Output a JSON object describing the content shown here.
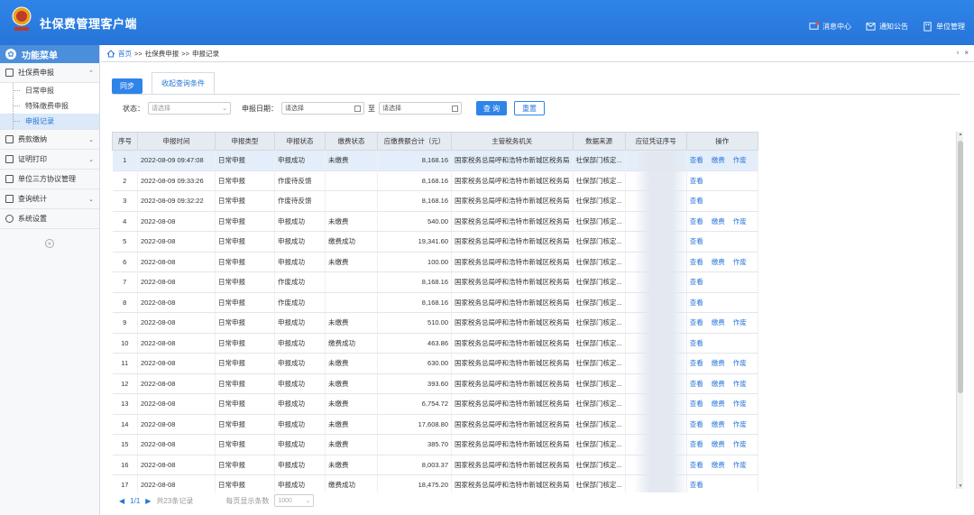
{
  "app": {
    "title": "社保费管理客户端",
    "logo_text": "中国税务"
  },
  "header_links": [
    {
      "icon": "message-icon",
      "label": "消息中心"
    },
    {
      "icon": "notice-icon",
      "label": "通知公告"
    },
    {
      "icon": "unit-icon",
      "label": "单位管理"
    }
  ],
  "sidebar": {
    "title": "功能菜单",
    "groups": [
      {
        "label": "社保费申报",
        "expanded": true,
        "items": [
          "日常申报",
          "特殊缴费申报",
          "申报记录"
        ]
      },
      {
        "label": "费款缴纳"
      },
      {
        "label": "证明打印"
      },
      {
        "label": "单位三方协议管理"
      },
      {
        "label": "查询统计"
      },
      {
        "label": "系统设置"
      }
    ]
  },
  "breadcrumb": {
    "home": "首页",
    "sep": ">>",
    "level1": "社保费申报",
    "level2": "申报记录"
  },
  "toolbar": {
    "sync_label": "同步",
    "tab_label": "收起查询条件"
  },
  "filter": {
    "status_label": "状态：",
    "status_placeholder": "请选择",
    "date_label": "申报日期：",
    "date_from_placeholder": "请选择",
    "to_label": "至",
    "date_to_placeholder": "请选择",
    "query_label": "查 询",
    "reset_label": "重置"
  },
  "table": {
    "headers": [
      "序号",
      "申报时间",
      "申报类型",
      "申报状态",
      "缴费状态",
      "应缴费额合计（元）",
      "主管税务机关",
      "数据来源",
      "应征凭证序号",
      "操作"
    ],
    "ops": {
      "view": "查看",
      "pay": "缴费",
      "void": "作废"
    },
    "rows": [
      {
        "no": "1",
        "time": "2022-08-09 09:47:08",
        "type": "日常申报",
        "status": "申报成功",
        "pay": "未缴费",
        "amount": "8,168.16",
        "org": "国家税务总局呼和浩特市新城区税务局",
        "src": "社保部门核定...",
        "ops": [
          "view",
          "pay",
          "void"
        ]
      },
      {
        "no": "2",
        "time": "2022-08-09 09:33:26",
        "type": "日常申报",
        "status": "作废待反馈",
        "pay": "",
        "amount": "8,168.16",
        "org": "国家税务总局呼和浩特市新城区税务局",
        "src": "社保部门核定...",
        "ops": [
          "view"
        ]
      },
      {
        "no": "3",
        "time": "2022-08-09 09:32:22",
        "type": "日常申报",
        "status": "作废待反馈",
        "pay": "",
        "amount": "8,168.16",
        "org": "国家税务总局呼和浩特市新城区税务局",
        "src": "社保部门核定...",
        "ops": [
          "view"
        ]
      },
      {
        "no": "4",
        "time": "2022-08-08",
        "type": "日常申报",
        "status": "申报成功",
        "pay": "未缴费",
        "amount": "540.00",
        "org": "国家税务总局呼和浩特市新城区税务局",
        "src": "社保部门核定...",
        "ops": [
          "view",
          "pay",
          "void"
        ]
      },
      {
        "no": "5",
        "time": "2022-08-08",
        "type": "日常申报",
        "status": "申报成功",
        "pay": "缴费成功",
        "amount": "19,341.60",
        "org": "国家税务总局呼和浩特市新城区税务局",
        "src": "社保部门核定...",
        "ops": [
          "view"
        ]
      },
      {
        "no": "6",
        "time": "2022-08-08",
        "type": "日常申报",
        "status": "申报成功",
        "pay": "未缴费",
        "amount": "100.00",
        "org": "国家税务总局呼和浩特市新城区税务局",
        "src": "社保部门核定...",
        "ops": [
          "view",
          "pay",
          "void"
        ]
      },
      {
        "no": "7",
        "time": "2022-08-08",
        "type": "日常申报",
        "status": "作废成功",
        "pay": "",
        "amount": "8,168.16",
        "org": "国家税务总局呼和浩特市新城区税务局",
        "src": "社保部门核定...",
        "ops": [
          "view"
        ]
      },
      {
        "no": "8",
        "time": "2022-08-08",
        "type": "日常申报",
        "status": "作废成功",
        "pay": "",
        "amount": "8,168.16",
        "org": "国家税务总局呼和浩特市新城区税务局",
        "src": "社保部门核定...",
        "ops": [
          "view"
        ]
      },
      {
        "no": "9",
        "time": "2022-08-08",
        "type": "日常申报",
        "status": "申报成功",
        "pay": "未缴费",
        "amount": "510.00",
        "org": "国家税务总局呼和浩特市新城区税务局",
        "src": "社保部门核定...",
        "ops": [
          "view",
          "pay",
          "void"
        ]
      },
      {
        "no": "10",
        "time": "2022-08-08",
        "type": "日常申报",
        "status": "申报成功",
        "pay": "缴费成功",
        "amount": "463.86",
        "org": "国家税务总局呼和浩特市新城区税务局",
        "src": "社保部门核定...",
        "ops": [
          "view"
        ]
      },
      {
        "no": "11",
        "time": "2022-08-08",
        "type": "日常申报",
        "status": "申报成功",
        "pay": "未缴费",
        "amount": "630.00",
        "org": "国家税务总局呼和浩特市新城区税务局",
        "src": "社保部门核定...",
        "ops": [
          "view",
          "pay",
          "void"
        ]
      },
      {
        "no": "12",
        "time": "2022-08-08",
        "type": "日常申报",
        "status": "申报成功",
        "pay": "未缴费",
        "amount": "393.60",
        "org": "国家税务总局呼和浩特市新城区税务局",
        "src": "社保部门核定...",
        "ops": [
          "view",
          "pay",
          "void"
        ]
      },
      {
        "no": "13",
        "time": "2022-08-08",
        "type": "日常申报",
        "status": "申报成功",
        "pay": "未缴费",
        "amount": "6,754.72",
        "org": "国家税务总局呼和浩特市新城区税务局",
        "src": "社保部门核定...",
        "ops": [
          "view",
          "pay",
          "void"
        ]
      },
      {
        "no": "14",
        "time": "2022-08-08",
        "type": "日常申报",
        "status": "申报成功",
        "pay": "未缴费",
        "amount": "17,608.80",
        "org": "国家税务总局呼和浩特市新城区税务局",
        "src": "社保部门核定...",
        "ops": [
          "view",
          "pay",
          "void"
        ]
      },
      {
        "no": "15",
        "time": "2022-08-08",
        "type": "日常申报",
        "status": "申报成功",
        "pay": "未缴费",
        "amount": "385.70",
        "org": "国家税务总局呼和浩特市新城区税务局",
        "src": "社保部门核定...",
        "ops": [
          "view",
          "pay",
          "void"
        ]
      },
      {
        "no": "16",
        "time": "2022-08-08",
        "type": "日常申报",
        "status": "申报成功",
        "pay": "未缴费",
        "amount": "8,003.37",
        "org": "国家税务总局呼和浩特市新城区税务局",
        "src": "社保部门核定...",
        "ops": [
          "view",
          "pay",
          "void"
        ]
      },
      {
        "no": "17",
        "time": "2022-08-08",
        "type": "日常申报",
        "status": "申报成功",
        "pay": "缴费成功",
        "amount": "18,475.20",
        "org": "国家税务总局呼和浩特市新城区税务局",
        "src": "社保部门核定...",
        "ops": [
          "view"
        ]
      }
    ]
  },
  "pager": {
    "page": "1/1",
    "total": "共23条记录",
    "per_page_label": "每页显示条数",
    "per_page_value": "1000"
  },
  "colors": {
    "primary": "#2f84e8",
    "header_bg": "#2775d9",
    "selected_row": "#e4eefa"
  }
}
